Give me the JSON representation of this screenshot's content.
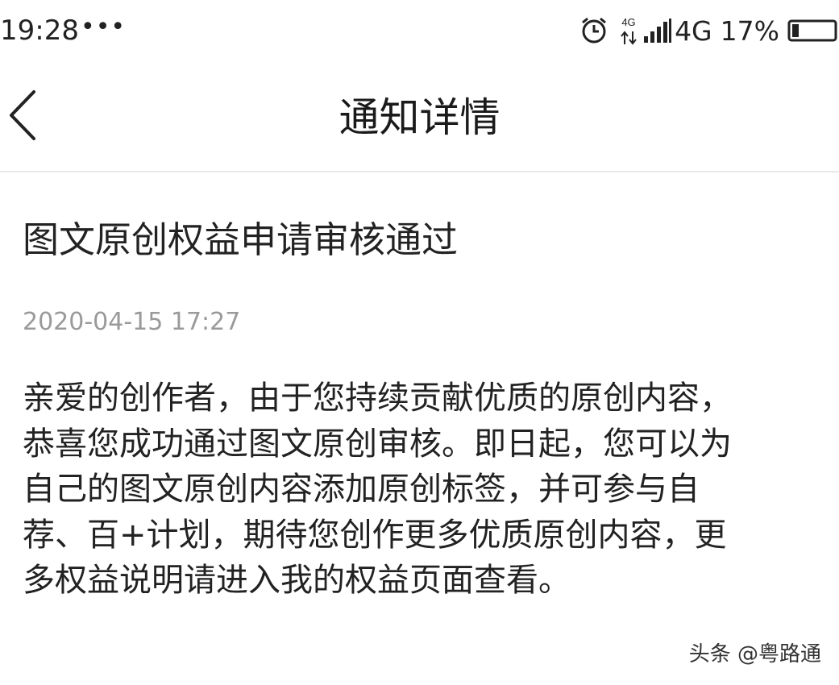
{
  "status_bar": {
    "time": "19:28",
    "overflow_indicator": "•••",
    "alarm_icon": "alarm-clock-icon",
    "network_type_small": "4G",
    "network_type": "4G",
    "battery_percent": "17%"
  },
  "nav": {
    "back_icon": "chevron-left-icon",
    "title": "通知详情"
  },
  "notice": {
    "title": "图文原创权益申请审核通过",
    "time": "2020-04-15 17:27",
    "body_lines": [
      "亲爱的创作者，由于您持续贡献优质的原创内容，",
      "恭喜您成功通过图文原创审核。即日起，您可以为",
      "自己的图文原创内容添加原创标签，并可参与自",
      "荐、百+计划，期待您创作更多优质原创内容，更",
      "多权益说明请进入我的权益页面查看。"
    ]
  },
  "watermark": "头条 @粤路通",
  "colors": {
    "text_primary": "#222222",
    "text_secondary": "#9a9a9a",
    "divider": "#e8e8e8",
    "background": "#ffffff"
  }
}
